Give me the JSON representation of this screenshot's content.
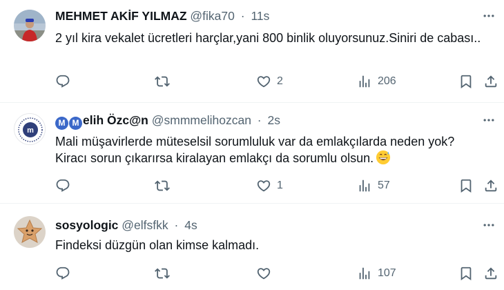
{
  "tweets": [
    {
      "name": "MEHMET AKİF YILMAZ",
      "handle": "@fika70",
      "dot": "·",
      "time": "11s",
      "text": "2 yıl kira vekalet ücretleri harçlar,yani 800 binlik oluyorsunuz.Siniri de cabası..",
      "likes": "2",
      "views": "206"
    },
    {
      "name_badge_1": "M",
      "name_badge_2": "M",
      "name": "elih Özc@n",
      "handle": "@smmmelihozcan",
      "dot": "·",
      "time": "2s",
      "text_line_1": "Mali müşavirlerde müteselsil sorumluluk var da emlakçılarda neden yok?",
      "text_line_2": "Kiracı sorun çıkarırsa kiralayan emlakçı da sorumlu olsun.",
      "likes": "1",
      "views": "57"
    },
    {
      "name": "sosyologic",
      "handle": "@elfsfkk",
      "dot": "·",
      "time": "4s",
      "text": "Findeksi düzgün olan kimse kalmadı.",
      "likes": "",
      "views": "107"
    }
  ],
  "icons": {
    "reply": "reply-icon",
    "retweet": "retweet-icon",
    "like": "heart-icon",
    "views": "views-icon",
    "bookmark": "bookmark-icon",
    "share": "share-icon",
    "more": "more-icon",
    "emoji": "grinning-sweat-emoji-icon"
  },
  "colors": {
    "text": "#0f1419",
    "secondary": "#536471",
    "divider": "#eff3f4",
    "badge": "#3b68c9"
  }
}
